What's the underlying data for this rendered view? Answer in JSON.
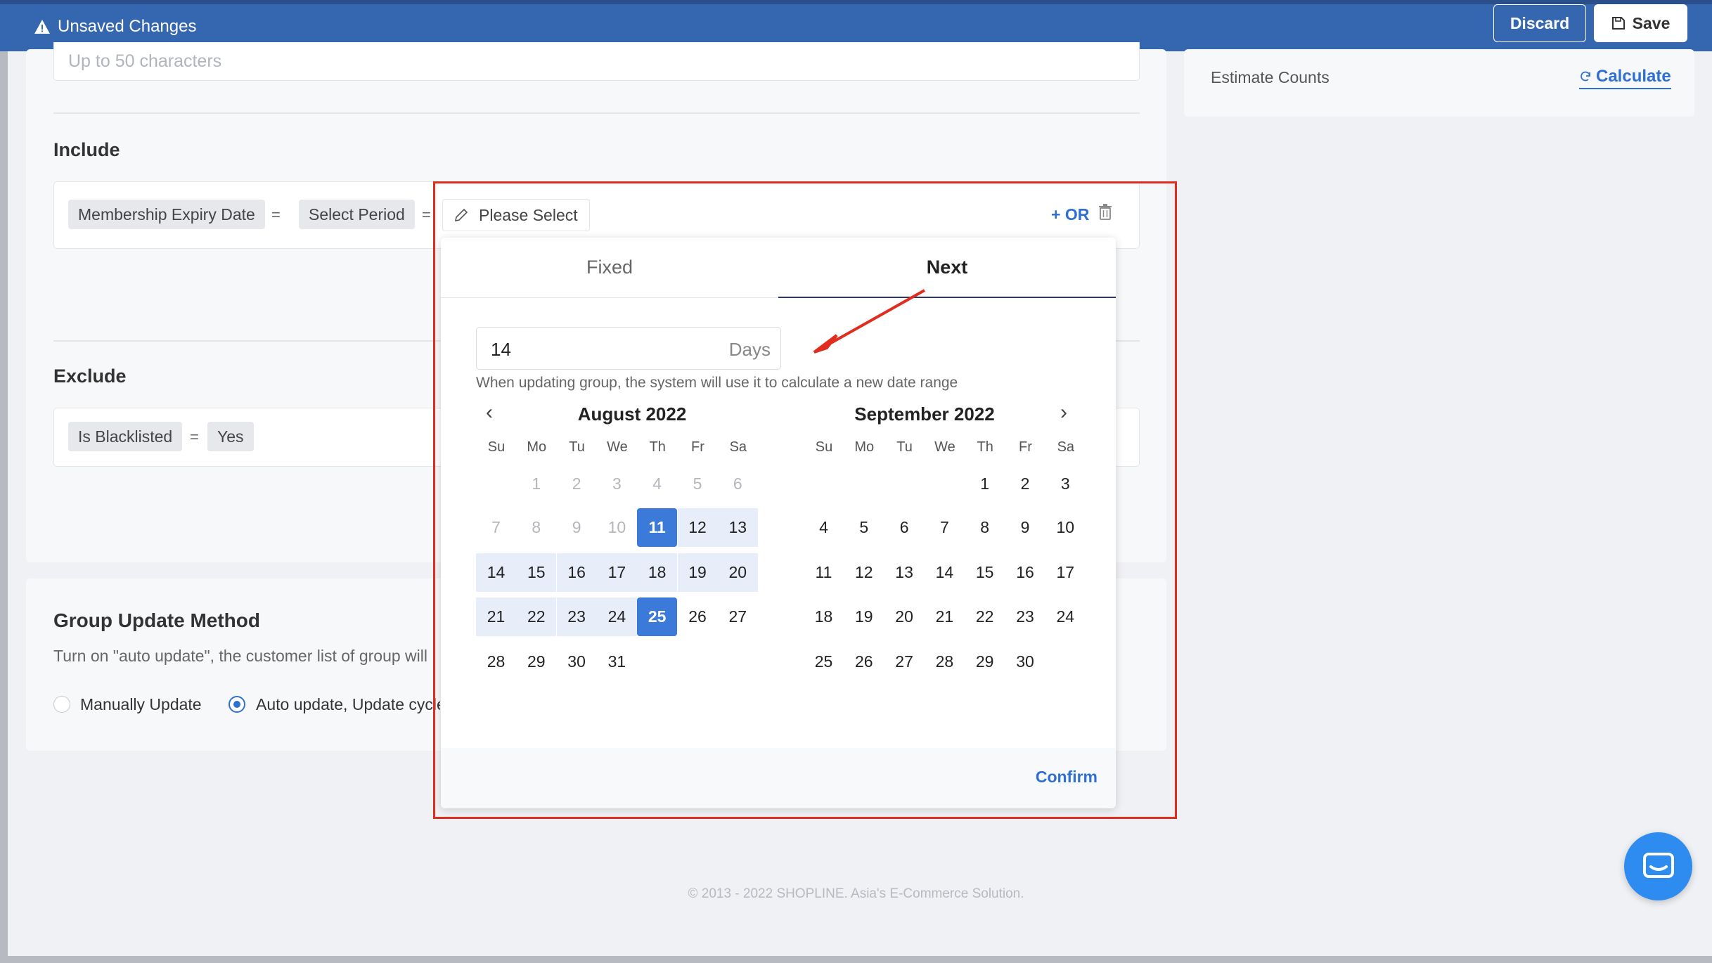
{
  "topbar": {
    "unsaved_label": "Unsaved Changes",
    "discard_label": "Discard",
    "save_label": "Save"
  },
  "group_name": {
    "placeholder": "Up to 50 characters"
  },
  "include": {
    "heading": "Include",
    "condition": {
      "field": "Membership Expiry Date",
      "operator": "=",
      "period": "Select Period",
      "operator2": "=",
      "value": "Please Select"
    },
    "or_label": "+ OR"
  },
  "exclude": {
    "heading": "Exclude",
    "condition": {
      "field": "Is Blacklisted",
      "operator": "=",
      "value": "Yes"
    }
  },
  "side": {
    "estimate_label": "Estimate Counts",
    "calculate_label": "Calculate"
  },
  "group_update": {
    "title": "Group Update Method",
    "description": "Turn on \"auto update\", the customer list of group will",
    "options": [
      {
        "label": "Manually Update",
        "selected": false
      },
      {
        "label": "Auto update, Update cycle",
        "selected": true
      }
    ]
  },
  "picker": {
    "tabs": [
      {
        "label": "Fixed",
        "active": false
      },
      {
        "label": "Next",
        "active": true
      }
    ],
    "days_value": "14",
    "days_unit": "Days",
    "hint": "When updating group, the system will use it to calculate a new date range",
    "weekdays": [
      "Su",
      "Mo",
      "Tu",
      "We",
      "Th",
      "Fr",
      "Sa"
    ],
    "months": [
      {
        "title": "August 2022",
        "first_weekday": 1,
        "days": 31,
        "disabled_before": 11,
        "range_start": 11,
        "range_end": 25
      },
      {
        "title": "September 2022",
        "first_weekday": 4,
        "days": 30
      }
    ],
    "confirm_label": "Confirm"
  },
  "footer": {
    "copyright": "© 2013 - 2022 SHOPLINE. Asia's E-Commerce Solution."
  },
  "colors": {
    "topbar": "#3566b0",
    "accent": "#2f6fd1",
    "selected_day": "#3b7ad9",
    "range_day": "#e7eefa",
    "annotation_red": "#e02d20",
    "chat_button": "#2e8cf0"
  },
  "icons": {
    "unsaved": "warning-triangle-icon",
    "save": "floppy-disk-icon",
    "calculate": "refresh-icon",
    "value": "pencil-icon",
    "delete": "trash-icon",
    "prev": "chevron-left-icon",
    "next": "chevron-right-icon",
    "chat": "chat-bubble-icon"
  }
}
